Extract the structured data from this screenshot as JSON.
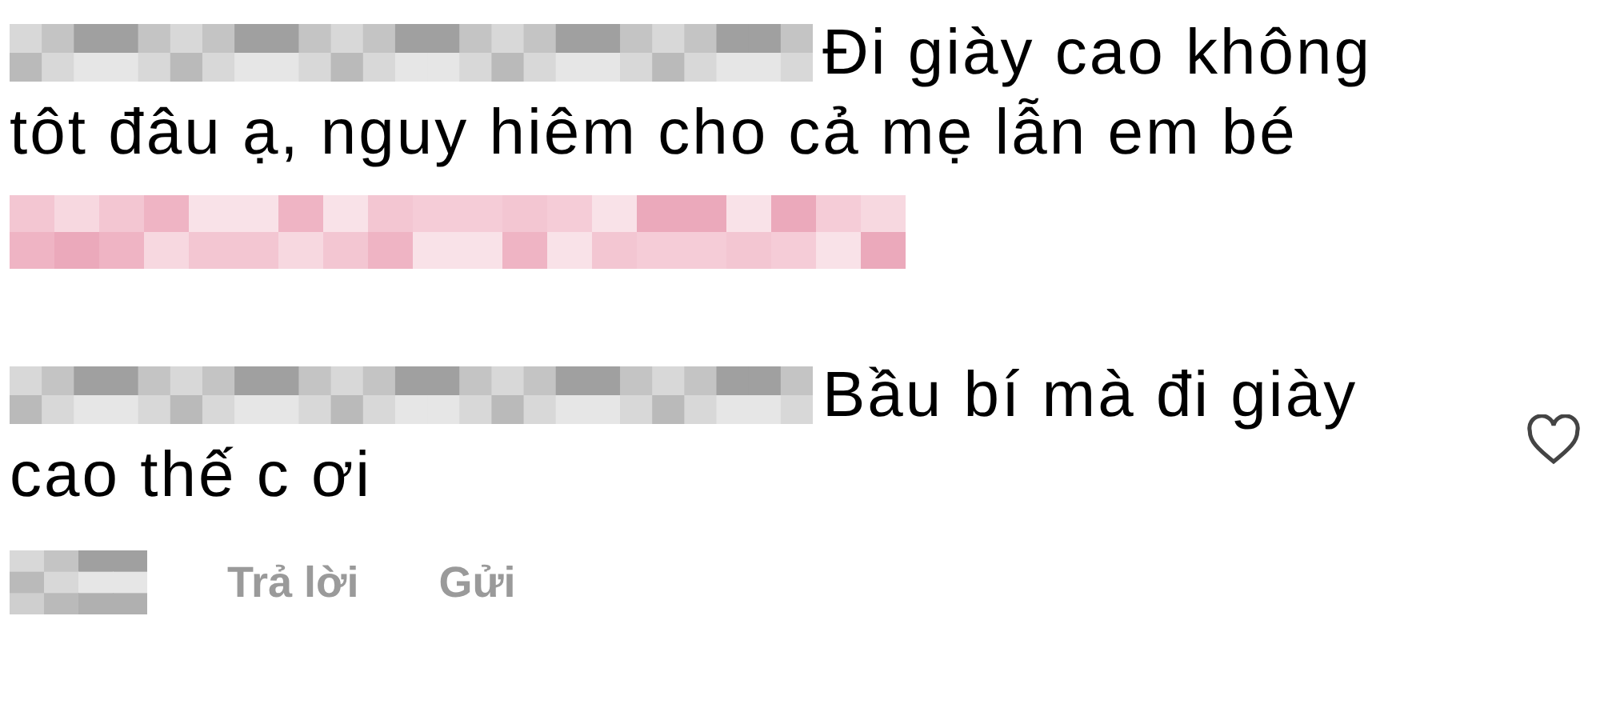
{
  "comments": [
    {
      "text_lines": [
        "Đi giày cao không",
        "tôt đâu ạ, nguy hiêm cho cả mẹ lẫn em bé"
      ],
      "has_like_button": false
    },
    {
      "text_lines": [
        "Bầu bí mà đi giày",
        "cao thế c ơi"
      ],
      "has_like_button": true
    }
  ],
  "actions": [
    "Trả lời",
    "Gửi"
  ]
}
